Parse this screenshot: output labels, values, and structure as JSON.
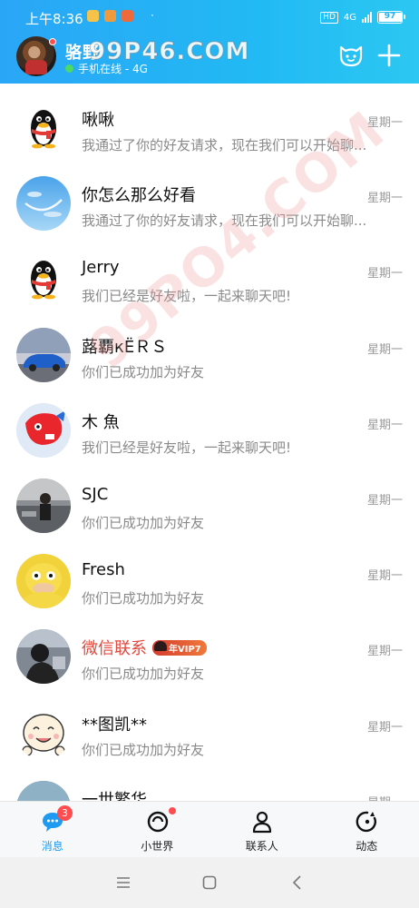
{
  "status_bar": {
    "time": "上午8:36",
    "dot": "·",
    "hd": "HD",
    "network": "4G",
    "battery": "97",
    "battery_level": 0.97
  },
  "header": {
    "profile_name": "骆野",
    "online_status": "手机在线 - 4G",
    "watermark": "99P46.COM",
    "icons": [
      "cat-face-icon",
      "plus-icon"
    ]
  },
  "watermark_diag": "99PO4.COM",
  "conversations": [
    {
      "name": "啾啾",
      "message": "我通过了你的好友请求，现在我们可以开始聊...",
      "time": "星期一",
      "avatar": "qq-penguin"
    },
    {
      "name": "你怎么那么好看",
      "message": "我通过了你的好友请求，现在我们可以开始聊...",
      "time": "星期一",
      "avatar": "blue-sky"
    },
    {
      "name": "Jerry",
      "message": "我们已经是好友啦，一起来聊天吧!",
      "time": "星期一",
      "avatar": "qq-penguin"
    },
    {
      "name": "蕗覇кЁＲＳ",
      "message": "你们已成功加为好友",
      "time": "星期一",
      "avatar": "blue-car"
    },
    {
      "name": "木 魚",
      "message": "我们已经是好友啦，一起来聊天吧!",
      "time": "星期一",
      "avatar": "red-cartoon"
    },
    {
      "name": "SJC",
      "message": "你们已成功加为好友",
      "time": "星期一",
      "avatar": "street-photo"
    },
    {
      "name": "Fresh",
      "message": "你们已成功加为好友",
      "time": "星期一",
      "avatar": "yellow-duck"
    },
    {
      "name": "微信联系",
      "message": "你们已成功加为好友",
      "time": "星期一",
      "avatar": "dark-figure",
      "vip": "年VIP7"
    },
    {
      "name": "**图凯**",
      "message": "你们已成功加为好友",
      "time": "星期一",
      "avatar": "cartoon-face"
    },
    {
      "name": "一世繁华",
      "message": "",
      "time": "星期一",
      "avatar": "landscape"
    }
  ],
  "tabs": [
    {
      "label": "消息",
      "badge": "3",
      "icon": "chat-bubble-icon"
    },
    {
      "label": "小世界",
      "icon": "world-circle-icon"
    },
    {
      "label": "联系人",
      "icon": "person-icon"
    },
    {
      "label": "动态",
      "icon": "refresh-star-icon"
    }
  ],
  "colors": {
    "header": "#22b0f5",
    "active_tab": "#1e9bf0",
    "badge": "#ff4d4f",
    "vip_name": "#e5473c"
  }
}
